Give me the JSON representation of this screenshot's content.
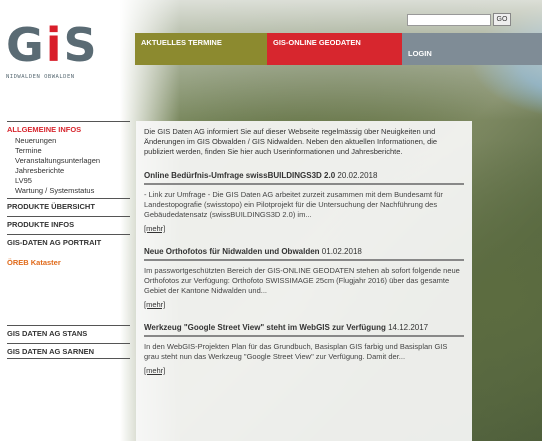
{
  "logo": {
    "letters": [
      "G",
      "i",
      "S"
    ],
    "subtitle": "NIDWALDEN OBWALDEN"
  },
  "search": {
    "value": "",
    "go_label": "GO"
  },
  "topnav": {
    "aktuelles": "AKTUELLES TERMINE",
    "gisonline": "GIS-ONLINE GEODATEN",
    "login": "LOGIN"
  },
  "colors": {
    "aktuelles_bg": "#8c8a2f",
    "gisonline_bg": "#d7262e",
    "login_bg": "#7f8c96",
    "active_red": "#d7262e",
    "oreb_orange": "#e06a1a"
  },
  "sidebar": {
    "allgemeine": "ALLGEMEINE INFOS",
    "sub_items": [
      "Neuerungen",
      "Termine",
      "Veranstaltungsunterlagen",
      "Jahresberichte",
      "LV95",
      "Wartung / Systemstatus"
    ],
    "produkte_uebersicht": "PRODUKTE ÜBERSICHT",
    "produkte_infos": "PRODUKTE INFOS",
    "portrait": "GIS-DATEN AG PORTRAIT",
    "oreb": "ÖREB Kataster",
    "stans": "GIS DATEN AG STANS",
    "sarnen": "GIS DATEN AG SARNEN"
  },
  "content": {
    "intro": "Die GIS Daten AG informiert Sie auf dieser Webseite regelmässig über Neuigkeiten und Änderungen im GIS Obwalden / GIS Nidwalden. Neben den aktuellen Informationen, die publiziert werden, finden Sie hier auch Userinformationen und Jahresberichte.",
    "news": [
      {
        "title": "Online Bedürfnis-Umfrage swissBUILDINGS3D 2.0",
        "date": "20.02.2018",
        "body": "- Link zur Umfrage - Die GIS Daten AG arbeitet zurzeit zusammen mit dem Bundesamt für Landestopografie (swisstopo) ein Pilotprojekt für die Untersuchung der Nachführung des Gebäudedatensatz (swissBUILDINGS3D 2.0) im...",
        "more": "[mehr]"
      },
      {
        "title": "Neue Orthofotos für Nidwalden und Obwalden",
        "date": "01.02.2018",
        "body": "Im passwortgeschützten Bereich der GIS-ONLINE GEODATEN stehen ab sofort folgende neue Orthofotos zur Verfügung: Orthofoto SWISSIMAGE 25cm (Flugjahr 2016) über das gesamte Gebiet der Kantone Nidwalden und...",
        "more": "[mehr]"
      },
      {
        "title": "Werkzeug \"Google Street View\" steht im WebGIS zur Verfügung",
        "date": "14.12.2017",
        "body": "In den WebGIS-Projekten Plan für das Grundbuch, Basisplan GIS farbig und Basisplan GIS grau steht nun das Werkzeug \"Google Street View\" zur Verfügung. Damit der...",
        "more": "[mehr]"
      }
    ]
  }
}
